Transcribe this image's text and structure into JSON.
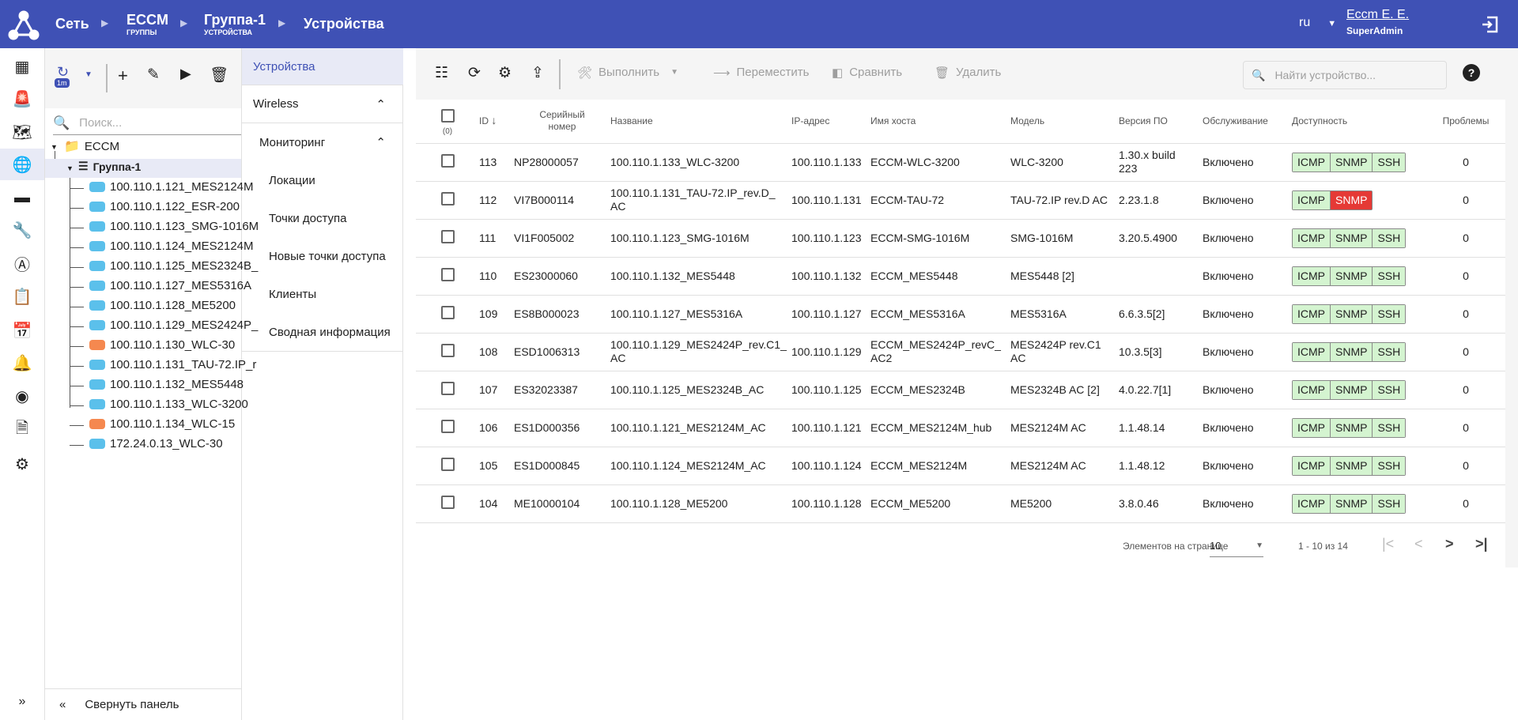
{
  "header": {
    "breadcrumbs": [
      {
        "title": "Сеть"
      },
      {
        "title": "ECCM",
        "sub": "группы"
      },
      {
        "title": "Группа-1",
        "sub": "устройства"
      },
      {
        "title": "Устройства"
      }
    ],
    "lang": "ru",
    "user": "Eccm E. E.",
    "role": "SuperAdmin"
  },
  "tree": {
    "refresh_badge": "1m",
    "search_placeholder": "Поиск...",
    "root": "ECCM",
    "group": "Группа-1",
    "devices": [
      {
        "name": "100.110.1.121_MES2124M",
        "c": "b"
      },
      {
        "name": "100.110.1.122_ESR-200",
        "c": "b"
      },
      {
        "name": "100.110.1.123_SMG-1016M",
        "c": "b"
      },
      {
        "name": "100.110.1.124_MES2124M",
        "c": "b"
      },
      {
        "name": "100.110.1.125_MES2324B_",
        "c": "b"
      },
      {
        "name": "100.110.1.127_MES5316A",
        "c": "b"
      },
      {
        "name": "100.110.1.128_ME5200",
        "c": "b"
      },
      {
        "name": "100.110.1.129_MES2424P_",
        "c": "b"
      },
      {
        "name": "100.110.1.130_WLC-30",
        "c": "o"
      },
      {
        "name": "100.110.1.131_TAU-72.IP_r",
        "c": "b"
      },
      {
        "name": "100.110.1.132_MES5448",
        "c": "b"
      },
      {
        "name": "100.110.1.133_WLC-3200",
        "c": "b"
      },
      {
        "name": "100.110.1.134_WLC-15",
        "c": "o"
      },
      {
        "name": "172.24.0.13_WLC-30",
        "c": "b"
      }
    ],
    "collapse_label": "Свернуть панель"
  },
  "nav": {
    "devices": "Устройства",
    "wireless": "Wireless",
    "monitoring": "Мониторинг",
    "items": [
      "Локации",
      "Точки доступа",
      "Новые точки доступа",
      "Клиенты",
      "Сводная информация"
    ]
  },
  "toolbar": {
    "execute": "Выполнить",
    "move": "Переместить",
    "compare": "Сравнить",
    "delete": "Удалить",
    "search_placeholder": "Найти устройство..."
  },
  "table": {
    "selected_count": "(0)",
    "headers": [
      "ID",
      "Серийный номер",
      "Название",
      "IP-адрес",
      "Имя хоста",
      "Модель",
      "Версия ПО",
      "Обслуживание",
      "Доступность",
      "Проблемы"
    ],
    "rows": [
      {
        "id": "113",
        "serial": "NP28000057",
        "name": "100.110.1.133_WLC-3200",
        "ip": "100.110.1.133",
        "host": "ECCM-WLC-3200",
        "model": "WLC-3200",
        "ver": "1.30.x build 223",
        "svc": "Включено",
        "avail": [
          "ICMP",
          "SNMP",
          "SSH"
        ],
        "bad": [],
        "prob": "0"
      },
      {
        "id": "112",
        "serial": "VI7B000114",
        "name": "100.110.1.131_TAU-72.IP_rev.D_ AC",
        "ip": "100.110.1.131",
        "host": "ECCM-TAU-72",
        "model": "TAU-72.IP rev.D AC",
        "ver": "2.23.1.8",
        "svc": "Включено",
        "avail": [
          "ICMP",
          "SNMP"
        ],
        "bad": [
          "SNMP"
        ],
        "prob": "0"
      },
      {
        "id": "111",
        "serial": "VI1F005002",
        "name": "100.110.1.123_SMG-1016M",
        "ip": "100.110.1.123",
        "host": "ECCM-SMG-1016M",
        "model": "SMG-1016M",
        "ver": "3.20.5.4900",
        "svc": "Включено",
        "avail": [
          "ICMP",
          "SNMP",
          "SSH"
        ],
        "bad": [],
        "prob": "0"
      },
      {
        "id": "110",
        "serial": "ES23000060",
        "name": "100.110.1.132_MES5448",
        "ip": "100.110.1.132",
        "host": "ECCM_MES5448",
        "model": "MES5448 [2]",
        "ver": "",
        "svc": "Включено",
        "avail": [
          "ICMP",
          "SNMP",
          "SSH"
        ],
        "bad": [],
        "prob": "0"
      },
      {
        "id": "109",
        "serial": "ES8B000023",
        "name": "100.110.1.127_MES5316A",
        "ip": "100.110.1.127",
        "host": "ECCM_MES5316A",
        "model": "MES5316A",
        "ver": "6.6.3.5[2]",
        "svc": "Включено",
        "avail": [
          "ICMP",
          "SNMP",
          "SSH"
        ],
        "bad": [],
        "prob": "0"
      },
      {
        "id": "108",
        "serial": "ESD1006313",
        "name": "100.110.1.129_MES2424P_rev.C1_ AC",
        "ip": "100.110.1.129",
        "host": "ECCM_MES2424P_revC_ AC2",
        "model": "MES2424P rev.C1 AC",
        "ver": "10.3.5[3]",
        "svc": "Включено",
        "avail": [
          "ICMP",
          "SNMP",
          "SSH"
        ],
        "bad": [],
        "prob": "0"
      },
      {
        "id": "107",
        "serial": "ES32023387",
        "name": "100.110.1.125_MES2324B_AC",
        "ip": "100.110.1.125",
        "host": "ECCM_MES2324B",
        "model": "MES2324B AC [2]",
        "ver": "4.0.22.7[1]",
        "svc": "Включено",
        "avail": [
          "ICMP",
          "SNMP",
          "SSH"
        ],
        "bad": [],
        "prob": "0"
      },
      {
        "id": "106",
        "serial": "ES1D000356",
        "name": "100.110.1.121_MES2124M_AC",
        "ip": "100.110.1.121",
        "host": "ECCM_MES2124M_hub",
        "model": "MES2124M AC",
        "ver": "1.1.48.14",
        "svc": "Включено",
        "avail": [
          "ICMP",
          "SNMP",
          "SSH"
        ],
        "bad": [],
        "prob": "0"
      },
      {
        "id": "105",
        "serial": "ES1D000845",
        "name": "100.110.1.124_MES2124M_AC",
        "ip": "100.110.1.124",
        "host": "ECCM_MES2124M",
        "model": "MES2124M AC",
        "ver": "1.1.48.12",
        "svc": "Включено",
        "avail": [
          "ICMP",
          "SNMP",
          "SSH"
        ],
        "bad": [],
        "prob": "0"
      },
      {
        "id": "104",
        "serial": "ME10000104",
        "name": "100.110.1.128_ME5200",
        "ip": "100.110.1.128",
        "host": "ECCM_ME5200",
        "model": "ME5200",
        "ver": "3.8.0.46",
        "svc": "Включено",
        "avail": [
          "ICMP",
          "SNMP",
          "SSH"
        ],
        "bad": [],
        "prob": "0"
      }
    ]
  },
  "pagination": {
    "label": "Элементов на странице",
    "size": "10",
    "range": "1 - 10 из 14"
  },
  "colors": {
    "primary": "#3f51b5",
    "ok": "#d4f4d0",
    "error": "#e53935"
  }
}
